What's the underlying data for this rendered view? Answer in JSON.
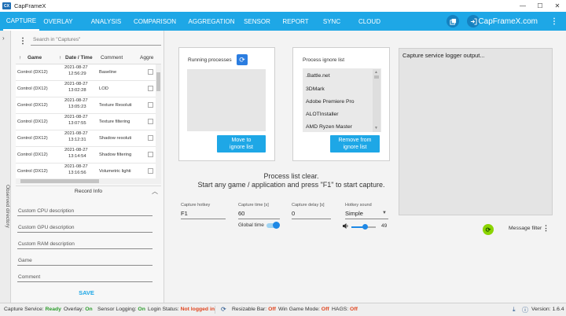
{
  "app": {
    "title": "CapFrameX",
    "logo_text": "CX"
  },
  "window_controls": {
    "minimize": "—",
    "maximize": "☐",
    "close": "✕"
  },
  "nav": {
    "tabs": [
      {
        "label": "CAPTURE",
        "active": true
      },
      {
        "label": "OVERLAY"
      },
      {
        "label": "ANALYSIS"
      },
      {
        "label": "COMPARISON"
      },
      {
        "label": "AGGREGATION"
      },
      {
        "label": "SENSOR"
      },
      {
        "label": "REPORT"
      },
      {
        "label": "SYNC"
      },
      {
        "label": "CLOUD"
      }
    ],
    "brand": "CapFrameX.com",
    "more": "⋮",
    "accent_color": "#1ea7e6"
  },
  "side": {
    "label": "Observed directory",
    "chevron": "›"
  },
  "captures": {
    "search_placeholder": "Search in \"Captures\"",
    "menu": "⋮",
    "columns": [
      "Game",
      "Date / Time",
      "Comment",
      "Aggre"
    ],
    "sort_arrow": "↑",
    "rows": [
      {
        "game": "Control (DX12)",
        "date": "2021-08-27",
        "time": "12:56:29",
        "comment": "Baseline"
      },
      {
        "game": "Control (DX12)",
        "date": "2021-08-27",
        "time": "13:02:28",
        "comment": "LOD"
      },
      {
        "game": "Control (DX12)",
        "date": "2021-08-27",
        "time": "13:05:23",
        "comment": "Texture Resoluti"
      },
      {
        "game": "Control (DX12)",
        "date": "2021-08-27",
        "time": "13:07:55",
        "comment": "Texture filtering"
      },
      {
        "game": "Control (DX12)",
        "date": "2021-08-27",
        "time": "13:12:31",
        "comment": "Shadow resoluti"
      },
      {
        "game": "Control (DX12)",
        "date": "2021-08-27",
        "time": "13:14:54",
        "comment": "Shadow filtering"
      },
      {
        "game": "Control (DX12)",
        "date": "2021-08-27",
        "time": "13:16:56",
        "comment": "Volumetric lighti"
      }
    ]
  },
  "record_info": {
    "title": "Record Info",
    "chevron": "︿",
    "fields": [
      "Custom CPU description",
      "Custom GPU description",
      "Custom RAM description",
      "Game",
      "Comment"
    ],
    "save_label": "SAVE"
  },
  "processes": {
    "running_title": "Running processes",
    "refresh_icon": "⟳",
    "move_button": "Move to\nignore list",
    "ignore_title": "Process ignore list",
    "ignore_items": [
      ".Battle.net",
      "3DMark",
      "Adobe Premiere Pro",
      "ALOTInstaller",
      "AMD Ryzen Master"
    ],
    "remove_button": "Remove from\nignore list"
  },
  "message": {
    "line1": "Process list clear.",
    "line2": "Start any game / application and press \"F1\" to start capture."
  },
  "settings": {
    "hotkey": {
      "label": "Capture hotkey",
      "value": "F1"
    },
    "capture_time": {
      "label": "Capture time [s]",
      "value": "60"
    },
    "capture_delay": {
      "label": "Capture delay [s]",
      "value": "0"
    },
    "hotkey_sound": {
      "label": "Hotkey sound",
      "value": "Simple"
    },
    "global_time": {
      "label": "Global time",
      "enabled": true
    },
    "volume": {
      "value": "49",
      "level": 0.49
    }
  },
  "log": {
    "title": "Capture service logger output...",
    "filter_label": "Message filter",
    "refresh_icon": "⟳",
    "more": "⋮"
  },
  "statusbar": {
    "capture_service_label": "Capture Service:",
    "capture_service_value": "Ready",
    "overlay_label": "Overlay:",
    "overlay_value": "On",
    "sensor_label": "Sensor Logging:",
    "sensor_value": "On",
    "login_label": "Login Status:",
    "login_value": "Not logged in",
    "resizable_label": "Resizable Bar:",
    "resizable_value": "Off",
    "game_mode_label": "Win Game Mode:",
    "game_mode_value": "Off",
    "hags_label": "HAGS:",
    "hags_value": "Off",
    "version_label": "Version: 1.6.4",
    "download_icon": "⤓",
    "info_icon": "ⓘ",
    "refresh_icon": "⟳"
  }
}
